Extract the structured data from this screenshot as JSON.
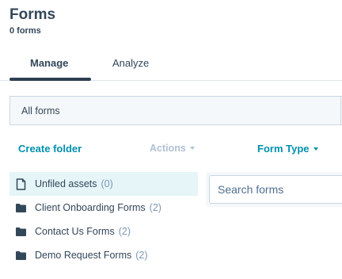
{
  "header": {
    "title": "Forms",
    "count": "0 forms"
  },
  "tabs": [
    {
      "label": "Manage",
      "active": true
    },
    {
      "label": "Analyze",
      "active": false
    }
  ],
  "view": {
    "label": "All forms"
  },
  "toolbar": {
    "create_folder": "Create folder",
    "actions": "Actions",
    "form_type": "Form Type"
  },
  "search": {
    "placeholder": "Search forms"
  },
  "folders": [
    {
      "icon": "file-icon",
      "name": "Unfiled assets",
      "count": "(0)",
      "selected": true
    },
    {
      "icon": "folder-icon",
      "name": "Client Onboarding Forms",
      "count": "(2)",
      "selected": false
    },
    {
      "icon": "folder-icon",
      "name": "Contact Us Forms",
      "count": "(2)",
      "selected": false
    },
    {
      "icon": "folder-icon",
      "name": "Demo Request Forms",
      "count": "(2)",
      "selected": false
    }
  ],
  "colors": {
    "link": "#0091ae",
    "text": "#33475b",
    "selected_bg": "#e5f5f8",
    "disabled": "#b0c1d4"
  }
}
